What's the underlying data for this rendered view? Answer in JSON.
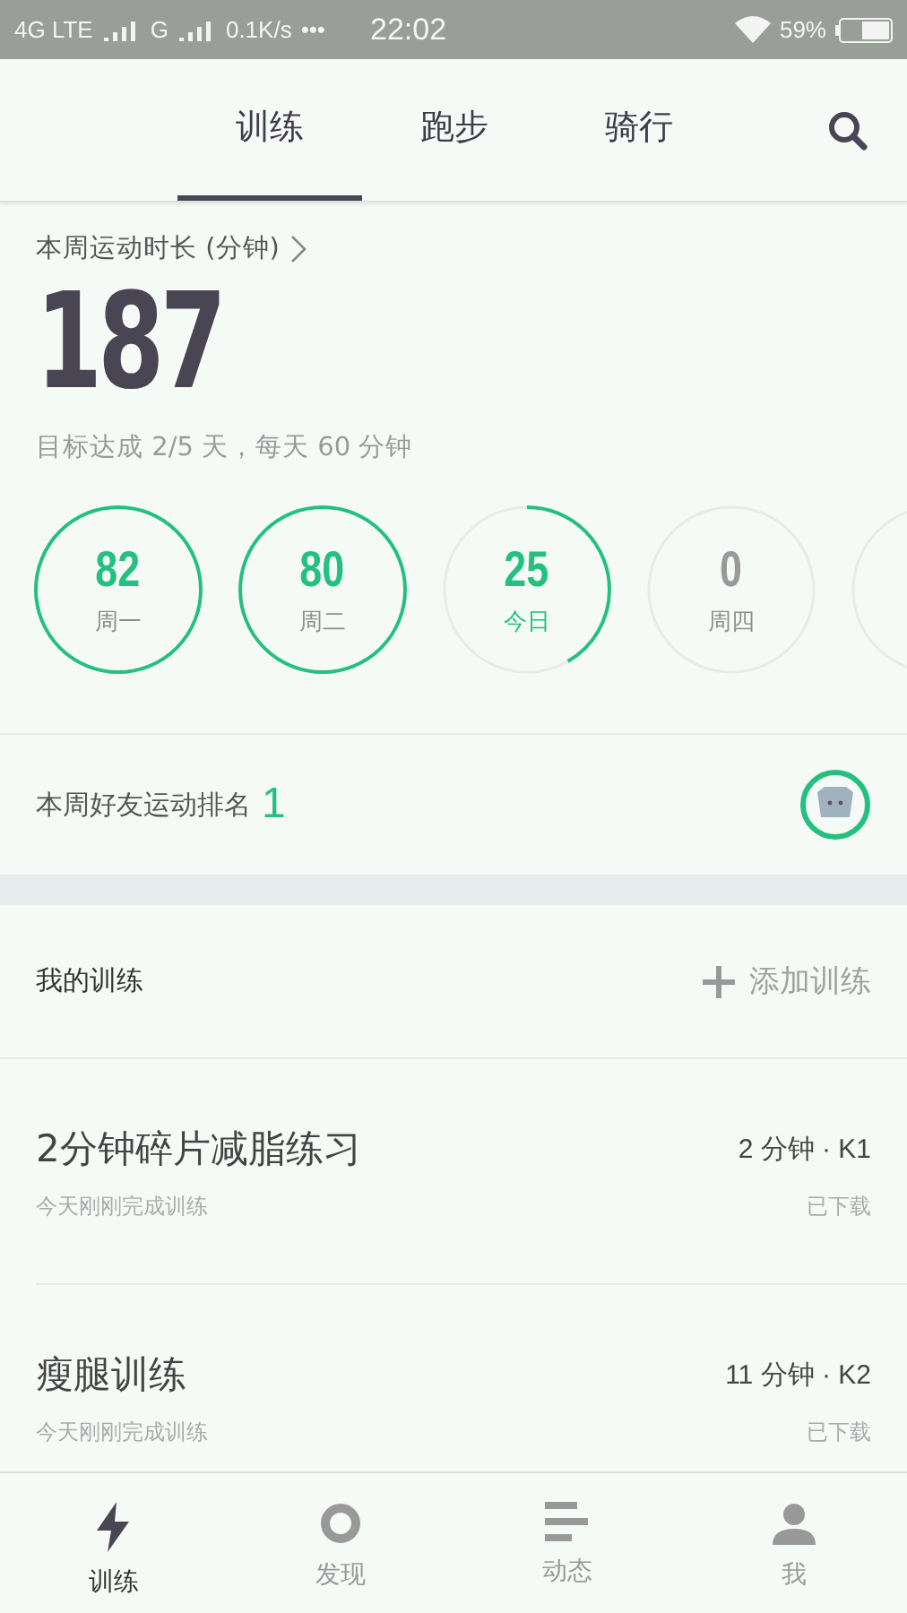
{
  "status_bar": {
    "network": "4G LTE",
    "network_2": "G",
    "speed": "0.1K/s",
    "more": "•••",
    "time": "22:02",
    "battery": "59%"
  },
  "tabs": [
    {
      "label": "训练",
      "selected": true
    },
    {
      "label": "跑步",
      "selected": false
    },
    {
      "label": "骑行",
      "selected": false
    }
  ],
  "summary": {
    "title": "本周运动时长 (分钟)",
    "total": "187",
    "goal": "目标达成 2/5 天，每天 60 分钟"
  },
  "days": [
    {
      "value": "82",
      "label": "周一",
      "selected": false
    },
    {
      "value": "80",
      "label": "周二",
      "selected": false
    },
    {
      "value": "25",
      "label": "今日",
      "selected": true
    },
    {
      "value": "0",
      "label": "周四",
      "selected": false
    }
  ],
  "ranking": {
    "label": "本周好友运动排名",
    "rank": "1"
  },
  "my_training": {
    "title": "我的训练",
    "add": "添加训练"
  },
  "workouts": [
    {
      "name": "2分钟碎片减脂练习",
      "meta": "2 分钟 · K1",
      "note": "今天刚刚完成训练",
      "status": "已下载"
    },
    {
      "name": "瘦腿训练",
      "meta": "11 分钟 · K2",
      "note": "今天刚刚完成训练",
      "status": "已下载"
    }
  ],
  "bottom_nav": [
    {
      "label": "训练",
      "selected": true
    },
    {
      "label": "发现",
      "selected": false
    },
    {
      "label": "动态",
      "selected": false
    },
    {
      "label": "我",
      "selected": false
    }
  ]
}
